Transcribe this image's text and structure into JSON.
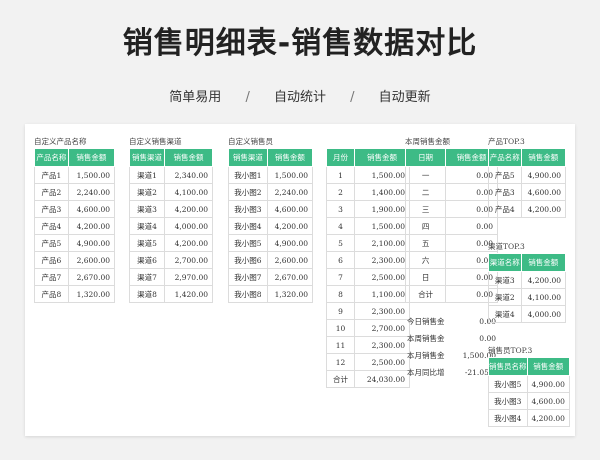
{
  "page": {
    "title": "销售明细表-销售数据对比",
    "features": [
      "简单易用",
      "自动统计",
      "自动更新"
    ],
    "separator": "/"
  },
  "colors": {
    "header_green": "#3dbb86",
    "page_bg": "#f2f2f2"
  },
  "product_table": {
    "caption": "自定义产品名称",
    "headers": [
      "产品名称",
      "销售金额"
    ],
    "rows": [
      [
        "产品1",
        "1,500.00"
      ],
      [
        "产品2",
        "2,240.00"
      ],
      [
        "产品3",
        "4,600.00"
      ],
      [
        "产品4",
        "4,200.00"
      ],
      [
        "产品5",
        "4,900.00"
      ],
      [
        "产品6",
        "2,600.00"
      ],
      [
        "产品7",
        "2,670.00"
      ],
      [
        "产品8",
        "1,320.00"
      ]
    ]
  },
  "channel_table": {
    "caption": "自定义销售渠道",
    "headers": [
      "销售渠道",
      "销售金额"
    ],
    "rows": [
      [
        "渠道1",
        "2,340.00"
      ],
      [
        "渠道2",
        "4,100.00"
      ],
      [
        "渠道3",
        "4,200.00"
      ],
      [
        "渠道4",
        "4,000.00"
      ],
      [
        "渠道5",
        "4,200.00"
      ],
      [
        "渠道6",
        "2,700.00"
      ],
      [
        "渠道7",
        "2,970.00"
      ],
      [
        "渠道8",
        "1,420.00"
      ]
    ]
  },
  "staff_table": {
    "caption": "自定义销售员",
    "headers": [
      "销售渠道",
      "销售金额"
    ],
    "rows": [
      [
        "我小图1",
        "1,500.00"
      ],
      [
        "我小图2",
        "2,240.00"
      ],
      [
        "我小图3",
        "4,600.00"
      ],
      [
        "我小图4",
        "4,200.00"
      ],
      [
        "我小图5",
        "4,900.00"
      ],
      [
        "我小图6",
        "2,600.00"
      ],
      [
        "我小图7",
        "2,670.00"
      ],
      [
        "我小图8",
        "1,320.00"
      ]
    ]
  },
  "month_table": {
    "headers": [
      "月份",
      "销售金额"
    ],
    "rows": [
      [
        "1",
        "1,500.00"
      ],
      [
        "2",
        "1,400.00"
      ],
      [
        "3",
        "1,900.00"
      ],
      [
        "4",
        "1,500.00"
      ],
      [
        "5",
        "2,100.00"
      ],
      [
        "6",
        "2,300.00"
      ],
      [
        "7",
        "2,500.00"
      ],
      [
        "8",
        "1,100.00"
      ],
      [
        "9",
        "2,300.00"
      ],
      [
        "10",
        "2,700.00"
      ],
      [
        "11",
        "2,300.00"
      ],
      [
        "12",
        "2,500.00"
      ],
      [
        "合计",
        "24,030.00"
      ]
    ]
  },
  "week_table": {
    "caption": "本周销售金额",
    "headers": [
      "日期",
      "销售金额"
    ],
    "rows": [
      [
        "一",
        "0.00"
      ],
      [
        "二",
        "0.00"
      ],
      [
        "三",
        "0.00"
      ],
      [
        "四",
        "0.00"
      ],
      [
        "五",
        "0.00"
      ],
      [
        "六",
        "0.00"
      ],
      [
        "日",
        "0.00"
      ],
      [
        "合计",
        "0.00"
      ]
    ]
  },
  "summary": {
    "rows": [
      [
        "今日销售金",
        "0.00"
      ],
      [
        "本周销售金",
        "0.00"
      ],
      [
        "本月销售金",
        "1,500.00"
      ],
      [
        "本月同比增",
        "-21.05%"
      ]
    ]
  },
  "top_product": {
    "caption": "产品TOP.3",
    "headers": [
      "产品名称",
      "销售金额"
    ],
    "rows": [
      [
        "产品5",
        "4,900.00"
      ],
      [
        "产品3",
        "4,600.00"
      ],
      [
        "产品4",
        "4,200.00"
      ]
    ]
  },
  "top_channel": {
    "caption": "渠道TOP.3",
    "headers": [
      "渠道名称",
      "销售金额"
    ],
    "rows": [
      [
        "渠道3",
        "4,200.00"
      ],
      [
        "渠道2",
        "4,100.00"
      ],
      [
        "渠道4",
        "4,000.00"
      ]
    ]
  },
  "top_staff": {
    "caption": "销售员TOP.3",
    "headers": [
      "销售员名称",
      "销售金额"
    ],
    "rows": [
      [
        "我小图5",
        "4,900.00"
      ],
      [
        "我小图3",
        "4,600.00"
      ],
      [
        "我小图4",
        "4,200.00"
      ]
    ]
  }
}
